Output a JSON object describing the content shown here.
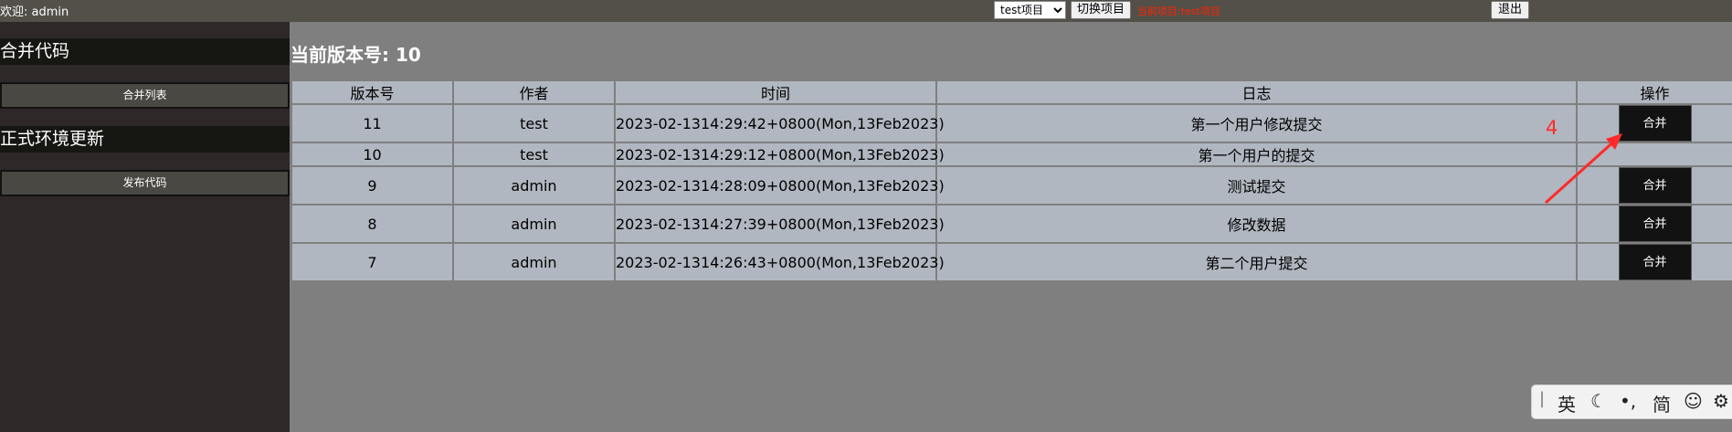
{
  "topbar": {
    "welcome": "欢迎: admin",
    "project_selected": "test项目",
    "switch_label": "切换项目",
    "current_project": "当前项目:test项目",
    "logout_label": "退出"
  },
  "sidebar": {
    "merge_heading": "合并代码",
    "merge_list_label": "合并列表",
    "prod_heading": "正式环境更新",
    "publish_label": "发布代码"
  },
  "main": {
    "version_title": "当前版本号: 10",
    "columns": [
      "版本号",
      "作者",
      "时间",
      "日志",
      "操作"
    ],
    "rows": [
      {
        "version": "11",
        "author": "test",
        "time": "2023-02-1314:29:42+0800(Mon,13Feb2023)",
        "log": "第一个用户修改提交",
        "action": "合并"
      },
      {
        "version": "10",
        "author": "test",
        "time": "2023-02-1314:29:12+0800(Mon,13Feb2023)",
        "log": "第一个用户的提交",
        "action": ""
      },
      {
        "version": "9",
        "author": "admin",
        "time": "2023-02-1314:28:09+0800(Mon,13Feb2023)",
        "log": "测试提交",
        "action": "合并"
      },
      {
        "version": "8",
        "author": "admin",
        "time": "2023-02-1314:27:39+0800(Mon,13Feb2023)",
        "log": "修改数据",
        "action": "合并"
      },
      {
        "version": "7",
        "author": "admin",
        "time": "2023-02-1314:26:43+0800(Mon,13Feb2023)",
        "log": "第二个用户提交",
        "action": "合并"
      }
    ]
  },
  "annotation": {
    "number": "4",
    "color": "#ff2a2a"
  },
  "ime": {
    "lang": "英",
    "moon_icon": "moon-icon",
    "punct": "•,",
    "simplified": "简",
    "smiley_icon": "smiley-icon"
  }
}
